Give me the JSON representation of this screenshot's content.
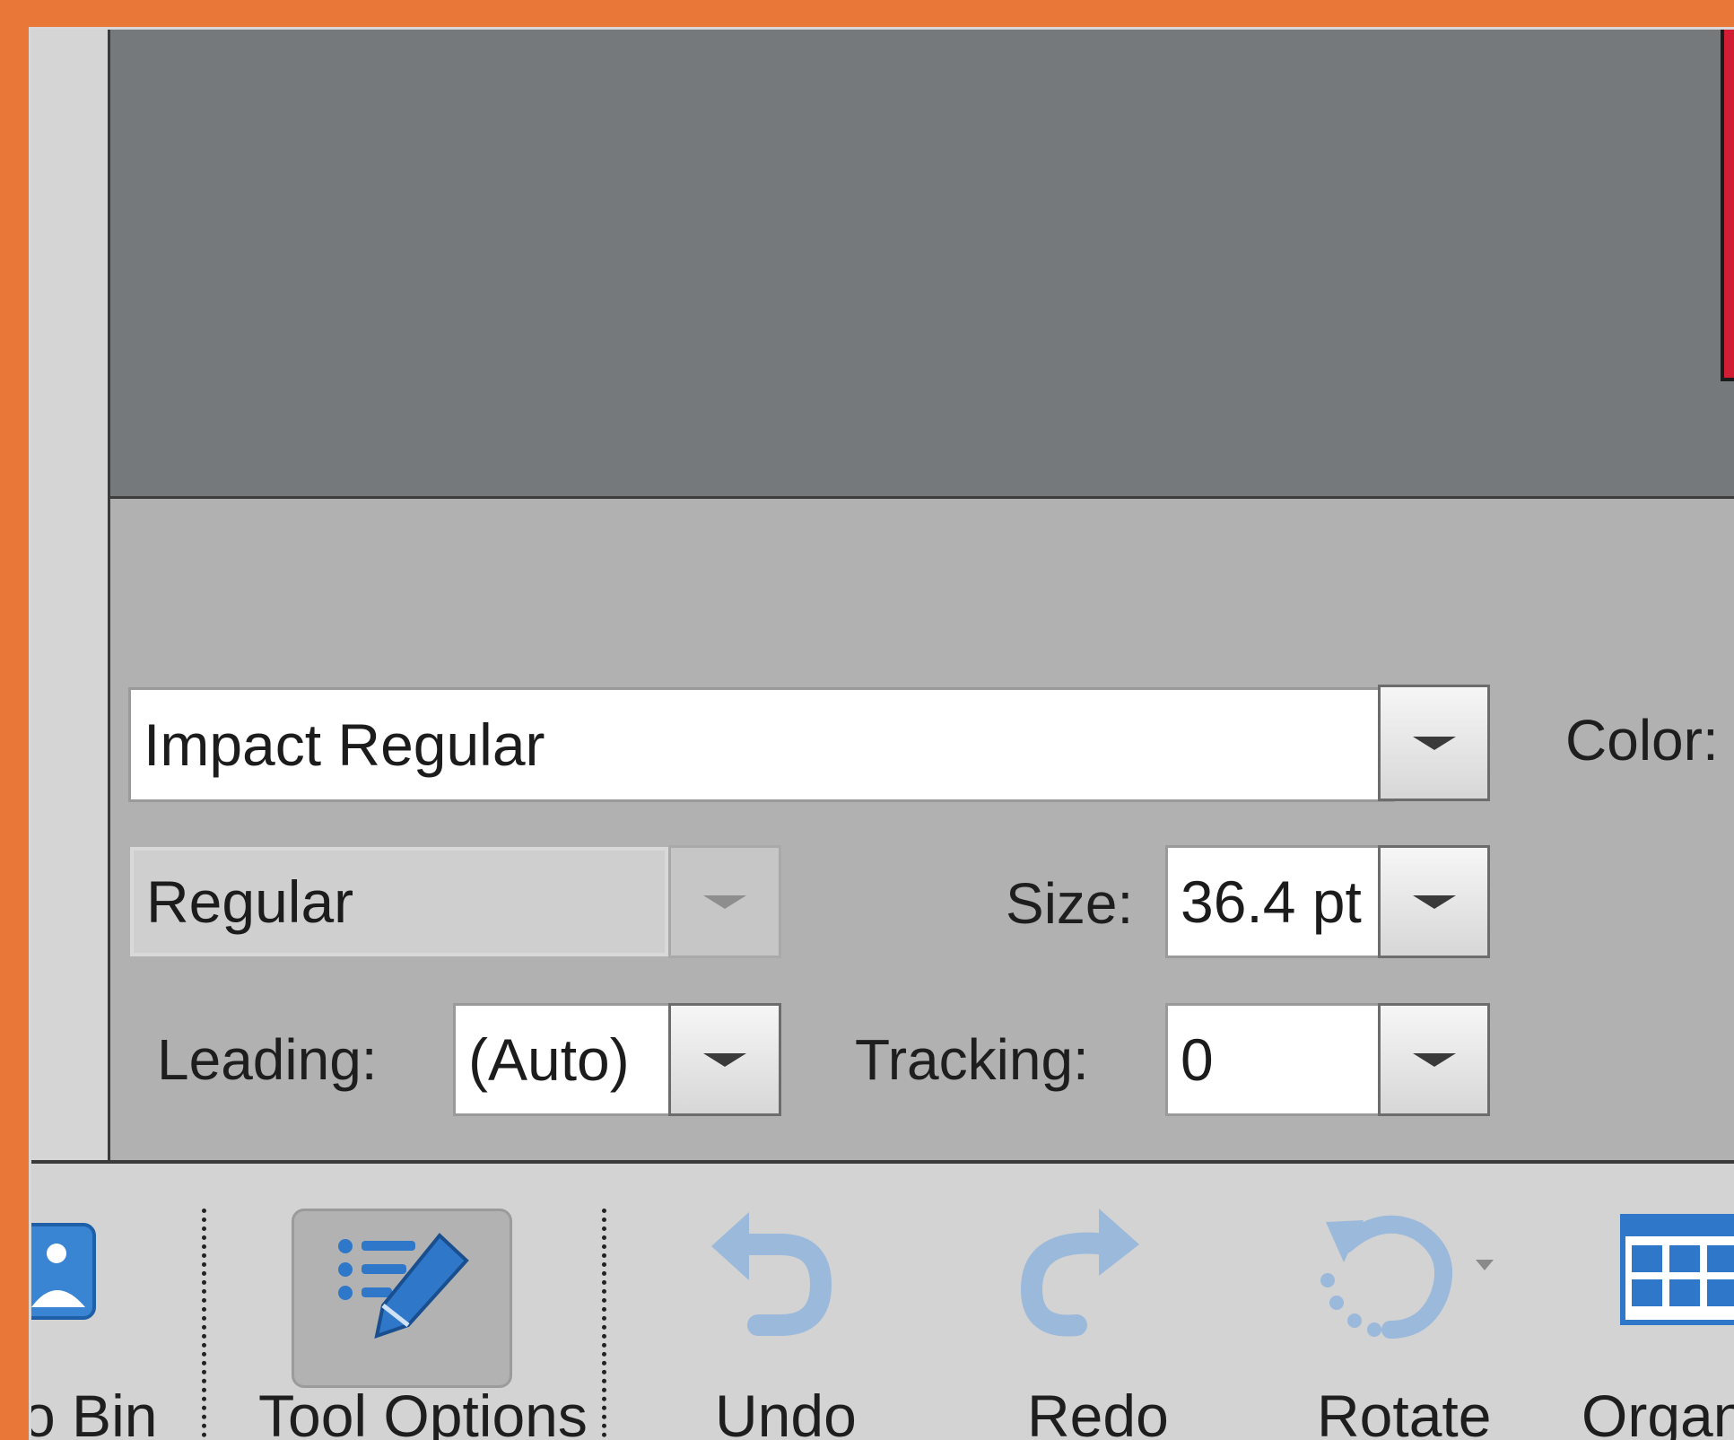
{
  "panel": {
    "font_family": "Impact Regular",
    "font_style": "Regular",
    "color_label": "Color:",
    "size_label": "Size:",
    "size_value": "36.4 pt",
    "leading_label": "Leading:",
    "leading_value": "(Auto)",
    "tracking_label": "Tracking:",
    "tracking_value": "0"
  },
  "toolbar": {
    "photo_bin": "o Bin",
    "tool_options": "Tool Options",
    "undo": "Undo",
    "redo": "Redo",
    "rotate": "Rotate",
    "organizer": "Organi"
  },
  "colors": {
    "accent_orange": "#e97838",
    "image_red": "#d11e35",
    "icon_blue": "#2f77c9"
  }
}
